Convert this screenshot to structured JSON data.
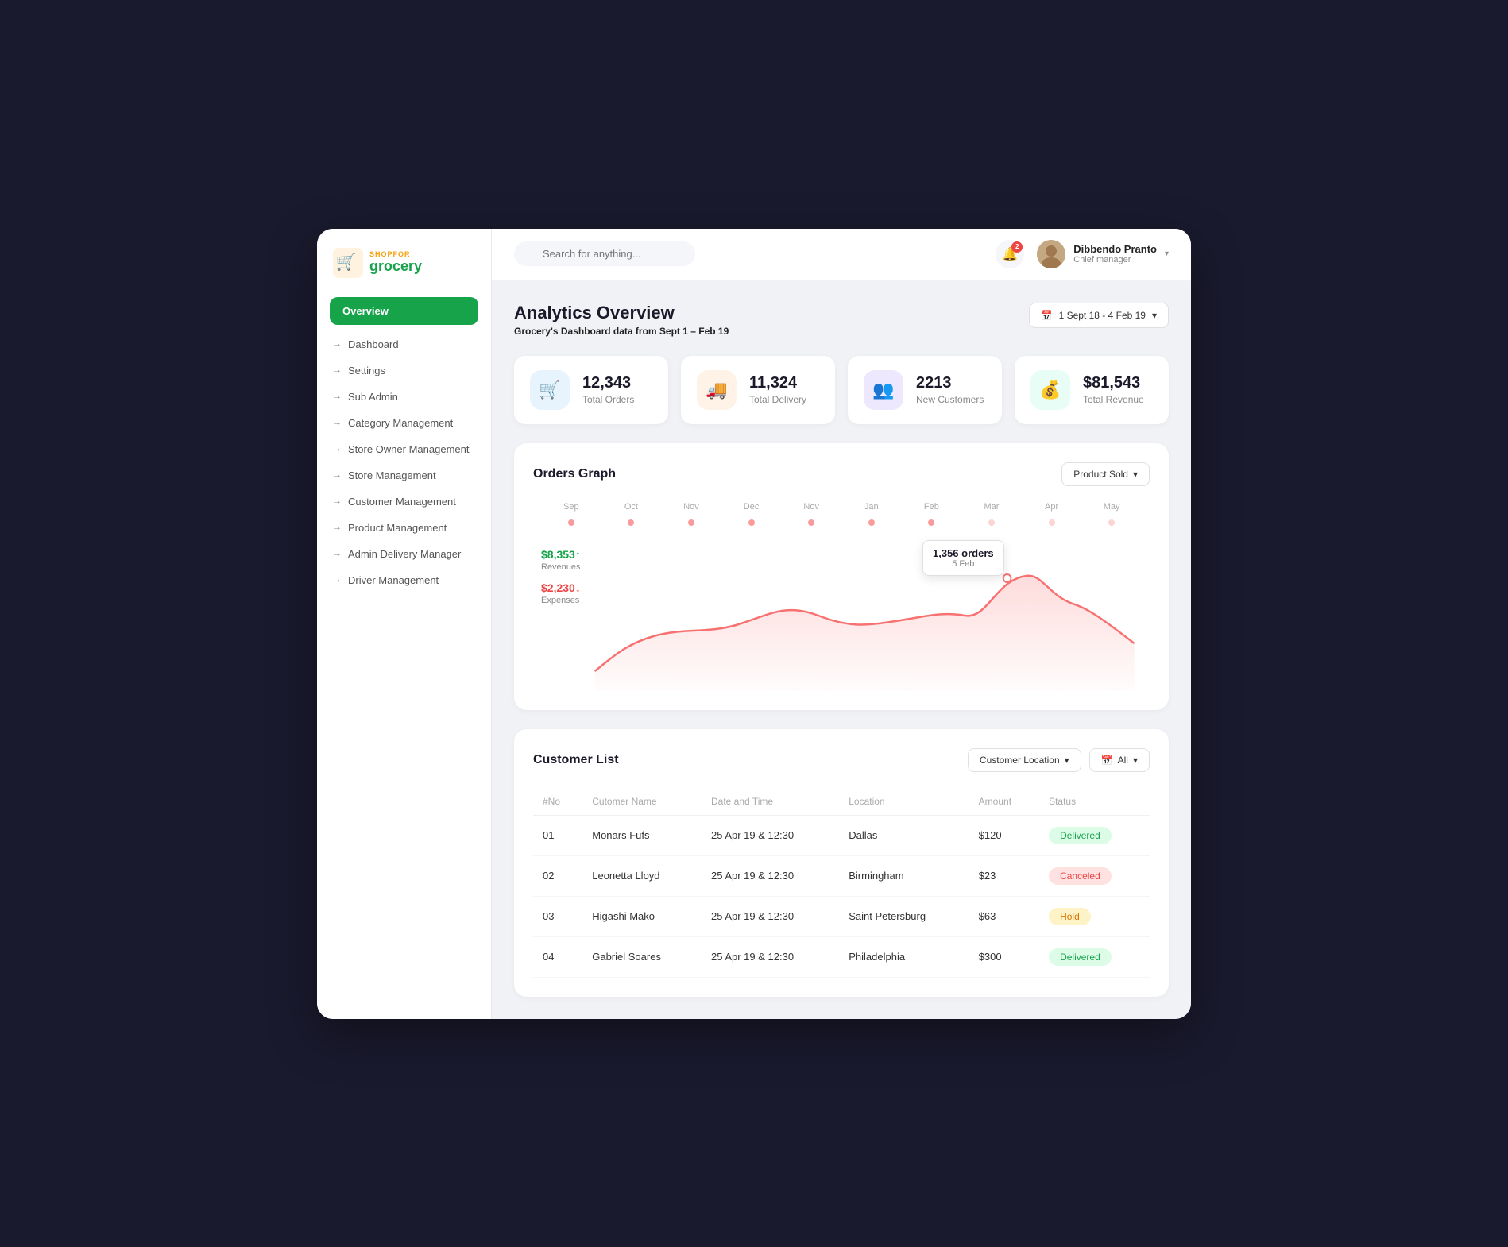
{
  "app": {
    "logo_shop": "SHOPFOR",
    "logo_grocery": "grocery"
  },
  "topbar": {
    "search_placeholder": "Search for anything...",
    "notification_count": "2",
    "user_name": "Dibbendo Pranto",
    "user_role": "Chief manager"
  },
  "sidebar": {
    "overview_label": "Overview",
    "nav_items": [
      {
        "label": "Dashboard"
      },
      {
        "label": "Settings"
      },
      {
        "label": "Sub Admin"
      },
      {
        "label": "Category Management"
      },
      {
        "label": "Store Owner Management"
      },
      {
        "label": "Store Management"
      },
      {
        "label": "Customer Management"
      },
      {
        "label": "Product Management"
      },
      {
        "label": "Admin Delivery Manager"
      },
      {
        "label": "Driver Management"
      }
    ]
  },
  "page": {
    "title": "Analytics Overview",
    "subtitle_prefix": "Grocery's Dashboard data from ",
    "subtitle_range": "Sept 1 – Feb 19",
    "date_range": "1 Sept 18 - 4 Feb 19"
  },
  "stats": [
    {
      "value": "12,343",
      "label": "Total Orders",
      "icon": "🛒",
      "color": "blue"
    },
    {
      "value": "11,324",
      "label": "Total Delivery",
      "icon": "🚚",
      "color": "orange"
    },
    {
      "value": "2213",
      "label": "New Customers",
      "icon": "👥",
      "color": "purple"
    },
    {
      "value": "$81,543",
      "label": "Total Revenue",
      "icon": "💰",
      "color": "teal"
    }
  ],
  "graph": {
    "title": "Orders Graph",
    "product_sold_label": "Product Sold",
    "months": [
      "Sep",
      "Oct",
      "Nov",
      "Dec",
      "Nov",
      "Jan",
      "Feb",
      "Mar",
      "Apr",
      "May"
    ],
    "revenues_label": "Revenues",
    "revenues_value": "$8,353↑",
    "expenses_label": "Expenses",
    "expenses_value": "$2,230↓",
    "tooltip_orders": "1,356 orders",
    "tooltip_date": "5 Feb"
  },
  "customer_list": {
    "title": "Customer List",
    "location_filter": "Customer Location",
    "date_filter": "All",
    "columns": [
      "#No",
      "Cutomer Name",
      "Date and Time",
      "Location",
      "Amount",
      "Status"
    ],
    "rows": [
      {
        "no": "01",
        "name": "Monars Fufs",
        "datetime": "25 Apr 19 & 12:30",
        "location": "Dallas",
        "amount": "$120",
        "status": "Delivered"
      },
      {
        "no": "02",
        "name": "Leonetta Lloyd",
        "datetime": "25 Apr 19 & 12:30",
        "location": "Birmingham",
        "amount": "$23",
        "status": "Canceled"
      },
      {
        "no": "03",
        "name": "Higashi Mako",
        "datetime": "25 Apr 19 & 12:30",
        "location": "Saint Petersburg",
        "amount": "$63",
        "status": "Hold"
      },
      {
        "no": "04",
        "name": "Gabriel Soares",
        "datetime": "25 Apr 19 & 12:30",
        "location": "Philadelphia",
        "amount": "$300",
        "status": "Delivered"
      }
    ]
  }
}
